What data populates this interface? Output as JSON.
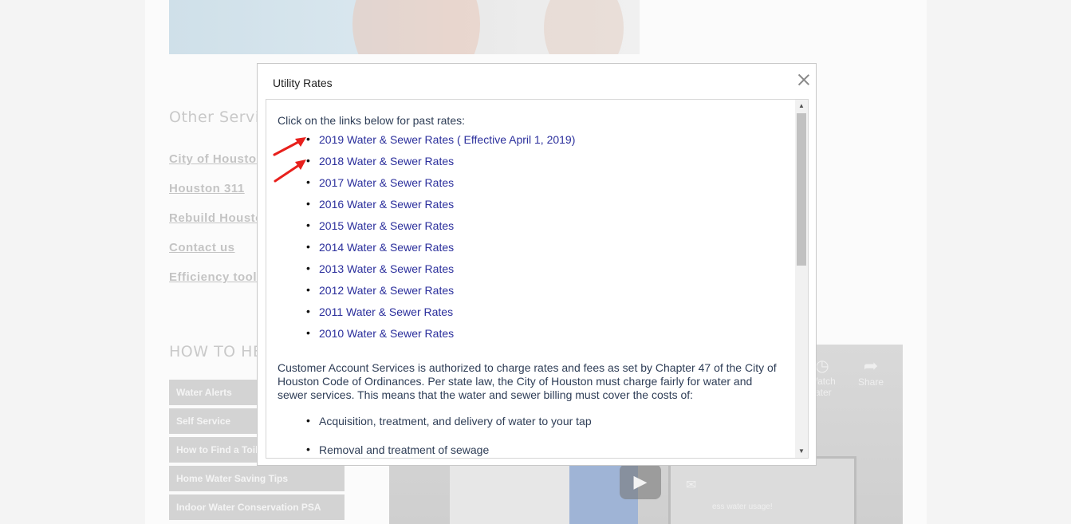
{
  "background": {
    "other_services_heading": "Other Services",
    "service_links": [
      "City of Houston",
      "Houston 311",
      "Rebuild Houston",
      "Contact us",
      "Efficiency tools"
    ],
    "how_to_help_heading": "HOW TO HELP",
    "help_buttons": [
      "Water Alerts",
      "Self Service",
      "How to Find a Toilet Leak",
      "Home Water Saving Tips",
      "Indoor Water Conservation PSA"
    ],
    "video": {
      "watch_later_label": "Watch later",
      "share_label": "Share",
      "usage_text": "ess water usage!"
    }
  },
  "modal": {
    "title": "Utility Rates",
    "intro": "Click on the links below for past rates:",
    "rate_links": [
      "2019 Water & Sewer Rates ( Effective April 1, 2019)",
      "2018 Water & Sewer Rates",
      "2017 Water & Sewer Rates",
      "2016 Water & Sewer Rates",
      "2015 Water & Sewer Rates",
      "2014 Water & Sewer Rates",
      "2013 Water & Sewer Rates",
      "2012 Water & Sewer Rates",
      "2011 Water & Sewer Rates",
      "2010 Water & Sewer Rates"
    ],
    "paragraph": "Customer Account Services is authorized to charge rates and fees as set by Chapter 47 of the City of Houston Code of Ordinances. Per state law, the City of Houston must charge fairly for water and sewer services. This means that the water and sewer billing must cover the costs of:",
    "cost_items": [
      "Acquisition, treatment, and delivery of water to your tap",
      "Removal and treatment of sewage"
    ]
  },
  "colors": {
    "link": "#2b2f9c",
    "body_text": "#2f3e57",
    "annotation_arrow": "#e8201c"
  },
  "icons": {
    "close": "close-icon",
    "scroll_up": "scroll-up-icon",
    "scroll_down": "scroll-down-icon",
    "play": "play-icon",
    "share": "share-icon",
    "watch_later": "clock-icon",
    "mail": "mail-icon"
  }
}
